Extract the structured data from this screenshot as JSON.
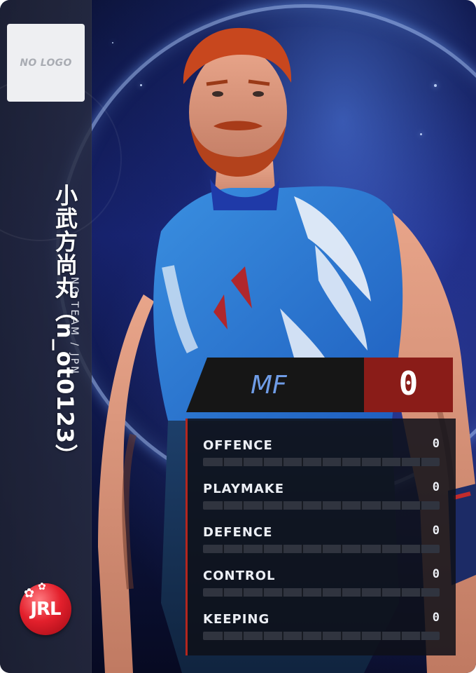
{
  "card": {
    "logo_placeholder": "NO LOGO",
    "player_name": "小武方尚丸（n_ot0123）",
    "team_country": "NO TEAM / JPN",
    "brand_logo": "JRL",
    "position": "MF",
    "overall_rating": "0",
    "stats": [
      {
        "label": "OFFENCE",
        "value": "0",
        "level": 0
      },
      {
        "label": "PLAYMAKE",
        "value": "0",
        "level": 0
      },
      {
        "label": "DEFENCE",
        "value": "0",
        "level": 0
      },
      {
        "label": "CONTROL",
        "value": "0",
        "level": 0
      },
      {
        "label": "KEEPING",
        "value": "0",
        "level": 0
      }
    ]
  },
  "colors": {
    "position_text": "#6f9ce6",
    "rating_bg": "#8a1c18",
    "panel_accent": "#b3261e",
    "bar_track": "#30343f"
  }
}
